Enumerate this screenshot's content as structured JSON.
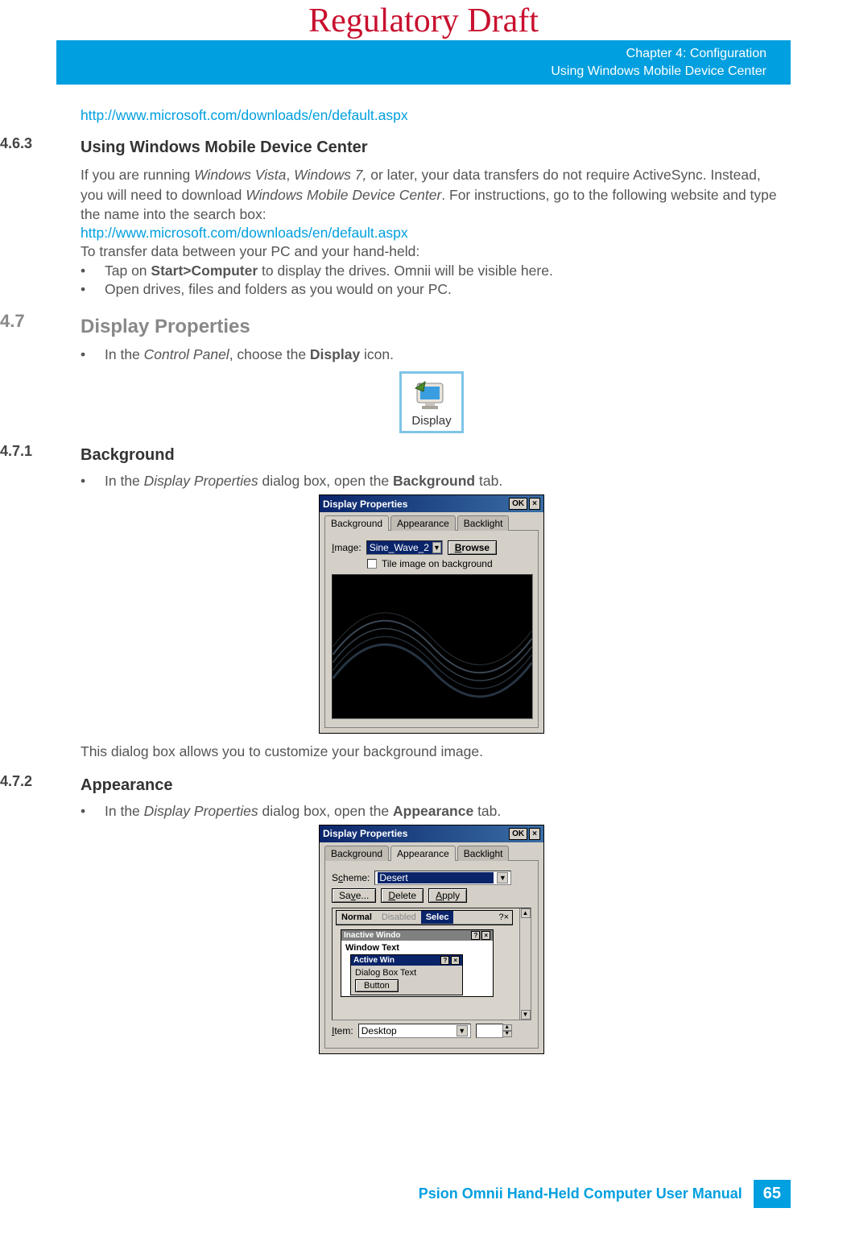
{
  "watermark": "Regulatory Draft",
  "header": {
    "chapter": "Chapter 4:  Configuration",
    "section": "Using Windows Mobile Device Center"
  },
  "link1": "http://www.microsoft.com/downloads/en/default.aspx",
  "s463": {
    "num": "4.6.3",
    "title": "Using Windows Mobile Device Center",
    "p1a": "If you are running ",
    "p1b": "Windows Vista",
    "p1c": ", ",
    "p1d": "Windows 7,",
    "p1e": " or later, your data transfers do not require ActiveSync. Instead, you will need to download ",
    "p1f": "Windows Mobile Device Center",
    "p1g": ". For instructions, go to the following website and type the name into the search box:",
    "link": "http://www.microsoft.com/downloads/en/default.aspx",
    "p2": "To transfer data between your PC and your hand-held:",
    "b1a": "Tap on ",
    "b1b": "Start>Computer",
    "b1c": " to display the drives. Omnii will be visible here.",
    "b2": "Open drives, files and folders as you would on your PC."
  },
  "s47": {
    "num": "4.7",
    "title": "Display Properties",
    "b1a": "In the ",
    "b1b": "Control Panel",
    "b1c": ", choose the ",
    "b1d": "Display",
    "b1e": " icon.",
    "icon_label": "Display"
  },
  "s471": {
    "num": "4.7.1",
    "title": "Background",
    "b1a": "In the ",
    "b1b": "Display Properties",
    "b1c": " dialog box, open the ",
    "b1d": "Background",
    "b1e": " tab.",
    "after": "This dialog box allows you to customize your background image."
  },
  "s472": {
    "num": "4.7.2",
    "title": "Appearance",
    "b1a": "In the ",
    "b1b": "Display Properties",
    "b1c": " dialog box, open the ",
    "b1d": "Appearance",
    "b1e": " tab."
  },
  "dlg1": {
    "title": "Display Properties",
    "ok": "OK",
    "tabs": [
      "Background",
      "Appearance",
      "Backlight"
    ],
    "image_label": "Image:",
    "image_value": "Sine_Wave_2",
    "browse": "Browse",
    "tile": "Tile image on background"
  },
  "dlg2": {
    "title": "Display Properties",
    "ok": "OK",
    "tabs": [
      "Background",
      "Appearance",
      "Backlight"
    ],
    "scheme_label": "Scheme:",
    "scheme_value": "Desert",
    "save": "Save...",
    "delete": "Delete",
    "apply": "Apply",
    "normal": "Normal",
    "disabled": "Disabled",
    "selec": "Selec",
    "inactive": "Inactive Windo",
    "window_text": "Window Text",
    "active": "Active Win",
    "dialog_text": "Dialog Box Text",
    "button": "Button",
    "item_label": "Item:",
    "item_value": "Desktop"
  },
  "footer": {
    "text": "Psion Omnii Hand-Held Computer User Manual",
    "page": "65"
  }
}
